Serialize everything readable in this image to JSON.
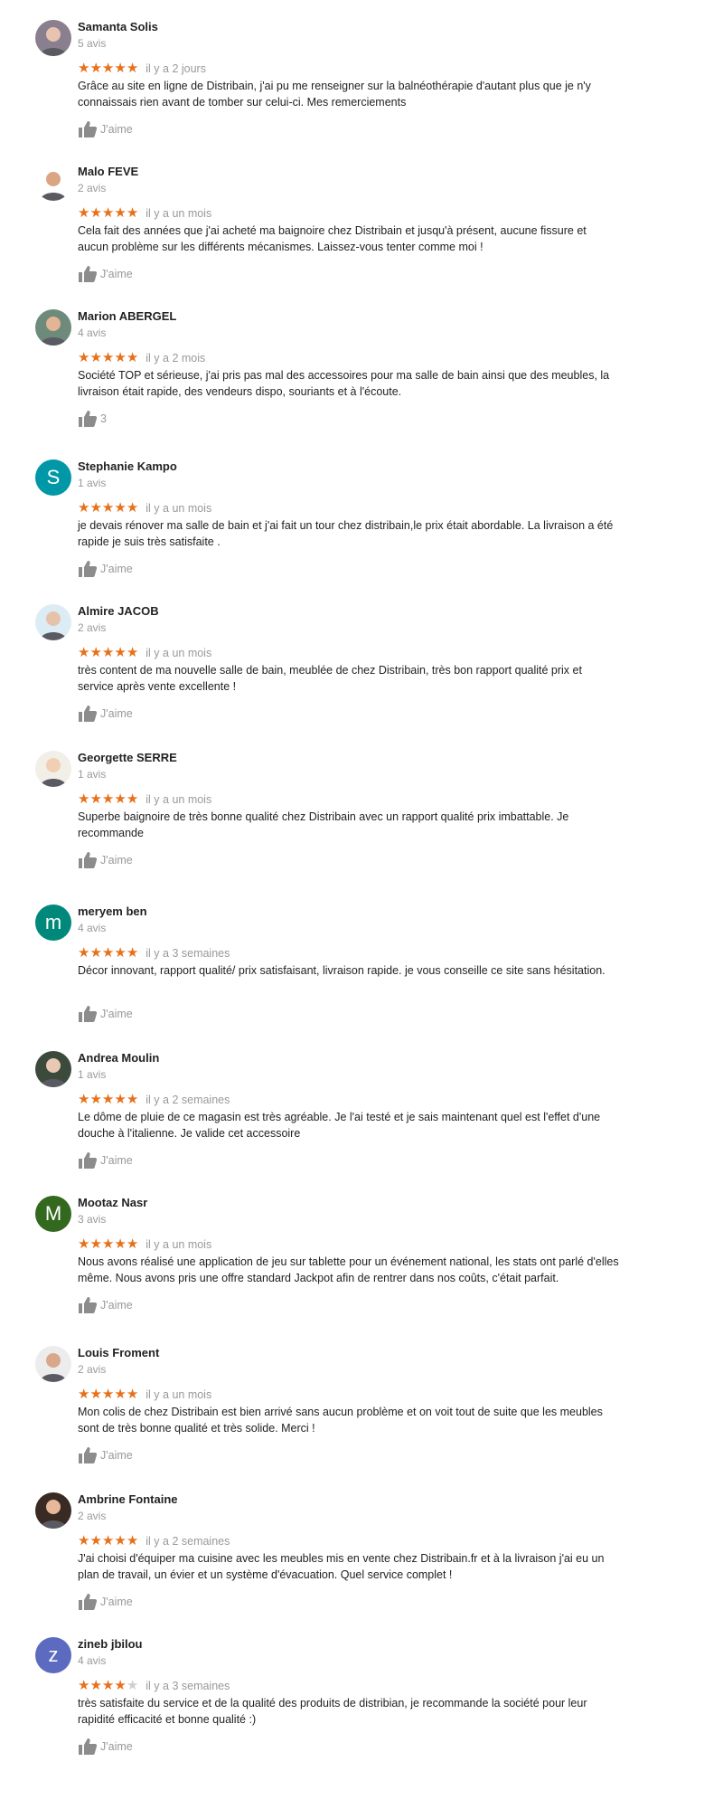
{
  "reviews": [
    {
      "name": "Samanta Solis",
      "count": "5 avis",
      "stars": 5,
      "time": "il y a 2 jours",
      "text": "Grâce au site en ligne de Distribain, j'ai pu me renseigner sur la balnéothérapie d'autant plus que je n'y connaissais rien avant de tomber sur celui-ci. Mes remerciements",
      "like": "J'aime",
      "avatar": {
        "type": "photo",
        "icon": "user-photo",
        "color": "#8a7f8e",
        "skin": "#e8c4b0"
      }
    },
    {
      "name": "Malo FEVE",
      "count": "2 avis",
      "stars": 5,
      "time": "il y a un mois",
      "text": "Cela fait des années que j'ai acheté ma baignoire chez Distribain et jusqu'à présent, aucune fissure et aucun problème sur les différents mécanismes. Laissez-vous tenter comme moi !",
      "like": "J'aime",
      "avatar": {
        "type": "photo",
        "icon": "user-photo",
        "color": "#ffffff",
        "skin": "#d9a583"
      }
    },
    {
      "name": "Marion ABERGEL",
      "count": "4 avis",
      "stars": 5,
      "time": "il y a 2 mois",
      "text": "Société TOP et sérieuse, j'ai pris pas mal des accessoires pour ma salle de bain ainsi que des meubles, la livraison était rapide, des vendeurs dispo, souriants et à l'écoute.",
      "like": "3",
      "avatar": {
        "type": "photo",
        "icon": "user-photo",
        "color": "#6e8a7a",
        "skin": "#e3b594"
      }
    },
    {
      "name": "Stephanie Kampo",
      "count": "1 avis",
      "stars": 5,
      "time": "il y a un mois",
      "text": "je devais rénover ma salle de bain et j'ai fait un tour chez distribain,le prix était abordable. La livraison a été rapide je suis très satisfaite .",
      "like": "J'aime",
      "avatar": {
        "type": "letter",
        "letter": "S",
        "color": "#0097a7"
      }
    },
    {
      "name": "Almire JACOB",
      "count": "2 avis",
      "stars": 5,
      "time": "il y a un mois",
      "text": "très content de ma nouvelle salle de bain, meublée de chez Distribain, très bon rapport qualité prix et service après vente excellente !",
      "like": "J'aime",
      "avatar": {
        "type": "photo",
        "icon": "user-photo",
        "color": "#dcecf5",
        "skin": "#e6c2a8"
      }
    },
    {
      "name": "Georgette SERRE",
      "count": "1 avis",
      "stars": 5,
      "time": "il y a un mois",
      "text": "Superbe baignoire de très bonne qualité chez Distribain avec un rapport qualité prix imbattable. Je recommande",
      "like": "J'aime",
      "avatar": {
        "type": "photo",
        "icon": "user-photo",
        "color": "#f2efe9",
        "skin": "#f0cfb5"
      }
    },
    {
      "name": "meryem ben",
      "count": "4 avis",
      "stars": 5,
      "time": "il y a 3 semaines",
      "text": "Décor innovant, rapport qualité/ prix satisfaisant, livraison rapide. je vous conseille ce site sans hésitation.",
      "like": "J'aime",
      "avatar": {
        "type": "letter",
        "letter": "m",
        "color": "#00897b"
      }
    },
    {
      "name": "Andrea Moulin",
      "count": "1 avis",
      "stars": 5,
      "time": "il y a 2 semaines",
      "text": "Le dôme de pluie de ce magasin est très agréable. Je l'ai testé et je sais maintenant quel est l'effet d'une douche à l'italienne. Je valide cet accessoire",
      "like": "J'aime",
      "avatar": {
        "type": "photo",
        "icon": "user-photo",
        "color": "#3b4a3a",
        "skin": "#e9c9b3"
      }
    },
    {
      "name": "Mootaz Nasr",
      "count": "3 avis",
      "stars": 5,
      "time": "il y a un mois",
      "text": "Nous avons réalisé une application de jeu sur tablette pour un événement national, les stats ont parlé d'elles même. Nous avons pris une offre standard Jackpot afin de rentrer dans nos coûts, c'était parfait.",
      "like": "J'aime",
      "avatar": {
        "type": "letter",
        "letter": "M",
        "color": "#33691e"
      }
    },
    {
      "name": "Louis Froment",
      "count": "2 avis",
      "stars": 5,
      "time": "il y a un mois",
      "text": "Mon colis de chez Distribain est bien arrivé sans aucun problème et on voit tout de suite que les meubles sont de très bonne qualité et très solide. Merci !",
      "like": "J'aime",
      "avatar": {
        "type": "photo",
        "icon": "user-photo",
        "color": "#ececec",
        "skin": "#d9a88a"
      }
    },
    {
      "name": "Ambrine Fontaine",
      "count": "2 avis",
      "stars": 5,
      "time": "il y a 2 semaines",
      "text": "J'ai choisi d'équiper ma cuisine avec les meubles mis en vente chez Distribain.fr et à la livraison j'ai eu un plan de travail, un évier et un système d'évacuation. Quel service complet !",
      "like": "J'aime",
      "avatar": {
        "type": "photo",
        "icon": "user-photo",
        "color": "#3a2a24",
        "skin": "#e7b99a"
      }
    },
    {
      "name": "zineb jbilou",
      "count": "4 avis",
      "stars": 4,
      "time": "il y a 3 semaines",
      "text": "très satisfaite du service et de la qualité des produits de distribian, je recommande la société pour leur rapidité efficacité et bonne qualité :)",
      "like": "J'aime",
      "avatar": {
        "type": "letter",
        "letter": "z",
        "color": "#5c6bc0"
      }
    }
  ],
  "colors": {
    "star": "#e7711b",
    "star_off": "#cfcfcf",
    "muted": "#999999",
    "thumb": "#8c8c8c"
  }
}
